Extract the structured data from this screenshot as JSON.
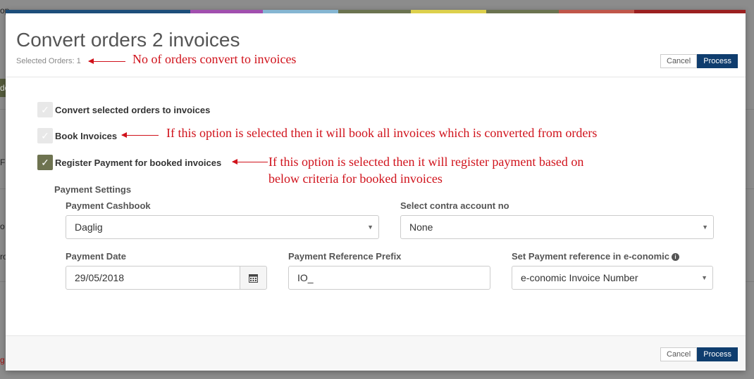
{
  "background": {
    "fragments": [
      "op",
      "do",
      "Fu",
      "o",
      "ro",
      "g"
    ]
  },
  "colors": {
    "accent_stripe": [
      "#1d4e7a",
      "#a14fae",
      "#85b6d2",
      "#6b7350",
      "#ddd04c",
      "#6b7350",
      "#c0564a",
      "#9b2020"
    ],
    "primary_button": "#0f3d6e",
    "checkbox_checked": "#6e7350",
    "annotation": "#d0121b"
  },
  "modal": {
    "title": "Convert orders 2 invoices",
    "selected_orders": "Selected Orders: 1",
    "cancel_label": "Cancel",
    "process_label": "Process"
  },
  "options": [
    {
      "label": "Convert selected orders to invoices",
      "checked": false
    },
    {
      "label": "Book Invoices",
      "checked": false
    },
    {
      "label": "Register Payment for booked invoices",
      "checked": true
    }
  ],
  "payment_settings": {
    "title": "Payment Settings",
    "cashbook": {
      "label": "Payment Cashbook",
      "value": "Daglig"
    },
    "contra_account": {
      "label": "Select contra account no",
      "value": "None"
    },
    "date": {
      "label": "Payment Date",
      "value": "29/05/2018",
      "icon": "calendar-icon"
    },
    "reference_prefix": {
      "label": "Payment Reference Prefix",
      "value": "IO_"
    },
    "reference_type": {
      "label": "Set Payment reference in e-conomic",
      "value": "e-conomic Invoice Number",
      "icon": "info-icon"
    }
  },
  "annotations": {
    "orders": "No of orders convert to invoices",
    "book": "If this option is selected then it will book all invoices which is converted from orders",
    "register_line1": "If this option is selected then it will register payment based on",
    "register_line2": "below criteria for booked invoices"
  }
}
